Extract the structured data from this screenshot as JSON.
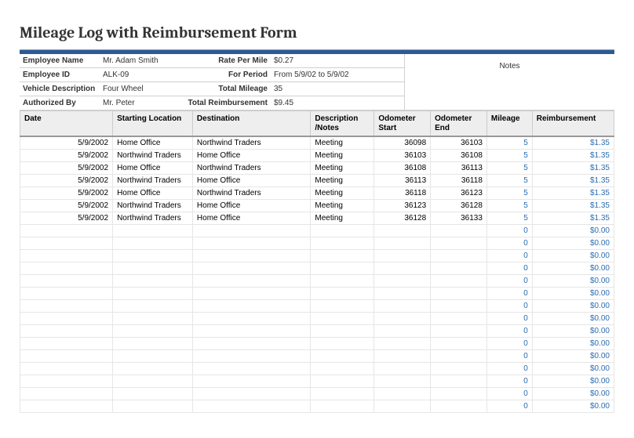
{
  "title": "Mileage Log with Reimbursement Form",
  "info": {
    "emp_name_label": "Employee Name",
    "emp_name": "Mr. Adam Smith",
    "rate_label": "Rate Per Mile",
    "rate": "$0.27",
    "emp_id_label": "Employee ID",
    "emp_id": "ALK-09",
    "period_label": "For Period",
    "period": "From 5/9/02 to 5/9/02",
    "vehicle_label": "Vehicle Description",
    "vehicle": "Four Wheel",
    "total_mileage_label": "Total Mileage",
    "total_mileage": "35",
    "auth_label": "Authorized By",
    "auth": "Mr. Peter",
    "total_reimb_label": "Total Reimbursement",
    "total_reimb": "$9.45",
    "notes_label": "Notes"
  },
  "headers": {
    "date": "Date",
    "start": "Starting Location",
    "dest": "Destination",
    "desc": "Description /Notes",
    "ostart": "Odometer Start",
    "oend": "Odometer End",
    "mileage": "Mileage",
    "reimb": "Reimbursement"
  },
  "rows": [
    {
      "date": "5/9/2002",
      "start": "Home Office",
      "dest": "Northwind Traders",
      "desc": "Meeting",
      "ostart": "36098",
      "oend": "36103",
      "mileage": "5",
      "reimb": "$1.35"
    },
    {
      "date": "5/9/2002",
      "start": "Northwind Traders",
      "dest": "Home Office",
      "desc": "Meeting",
      "ostart": "36103",
      "oend": "36108",
      "mileage": "5",
      "reimb": "$1.35"
    },
    {
      "date": "5/9/2002",
      "start": "Home Office",
      "dest": "Northwind Traders",
      "desc": "Meeting",
      "ostart": "36108",
      "oend": "36113",
      "mileage": "5",
      "reimb": "$1.35"
    },
    {
      "date": "5/9/2002",
      "start": "Northwind Traders",
      "dest": "Home Office",
      "desc": "Meeting",
      "ostart": "36113",
      "oend": "36118",
      "mileage": "5",
      "reimb": "$1.35"
    },
    {
      "date": "5/9/2002",
      "start": "Home Office",
      "dest": "Northwind Traders",
      "desc": "Meeting",
      "ostart": "36118",
      "oend": "36123",
      "mileage": "5",
      "reimb": "$1.35"
    },
    {
      "date": "5/9/2002",
      "start": "Northwind Traders",
      "dest": "Home Office",
      "desc": "Meeting",
      "ostart": "36123",
      "oend": "36128",
      "mileage": "5",
      "reimb": "$1.35"
    },
    {
      "date": "5/9/2002",
      "start": "Northwind Traders",
      "dest": "Home Office",
      "desc": "Meeting",
      "ostart": "36128",
      "oend": "36133",
      "mileage": "5",
      "reimb": "$1.35"
    }
  ],
  "empty_row": {
    "mileage": "0",
    "reimb": "$0.00"
  },
  "empty_count": 15
}
